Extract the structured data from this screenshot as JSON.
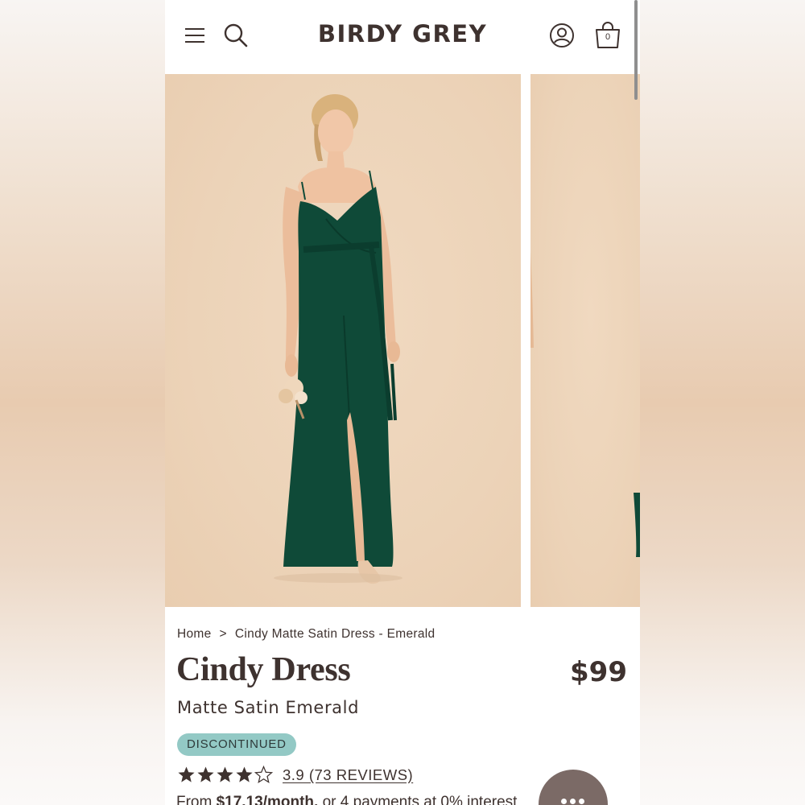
{
  "header": {
    "logo": "BIRDY GREY",
    "cart_count": "0"
  },
  "breadcrumb": {
    "home": "Home",
    "separator": ">",
    "current": "Cindy Matte Satin Dress - Emerald"
  },
  "product": {
    "title": "Cindy Dress",
    "price": "$99",
    "subtitle": "Matte Satin Emerald",
    "badge": "DISCONTINUED",
    "rating": 3.9,
    "rating_max": 5,
    "rating_link": "3.9 (73 REVIEWS)",
    "installments_prefix": "From ",
    "installments_amount": "$17.13/month,",
    "installments_suffix": " or 4 payments at 0% interest"
  },
  "colors": {
    "text": "#3e322f",
    "badge_bg": "#93c9c5",
    "photo_bg": "#ecd3b8",
    "dress": "#0f4a38",
    "chat_button": "#7b6a66"
  },
  "icons": [
    "menu-icon",
    "search-icon",
    "account-icon",
    "cart-icon",
    "star-icon",
    "chat-icon"
  ]
}
